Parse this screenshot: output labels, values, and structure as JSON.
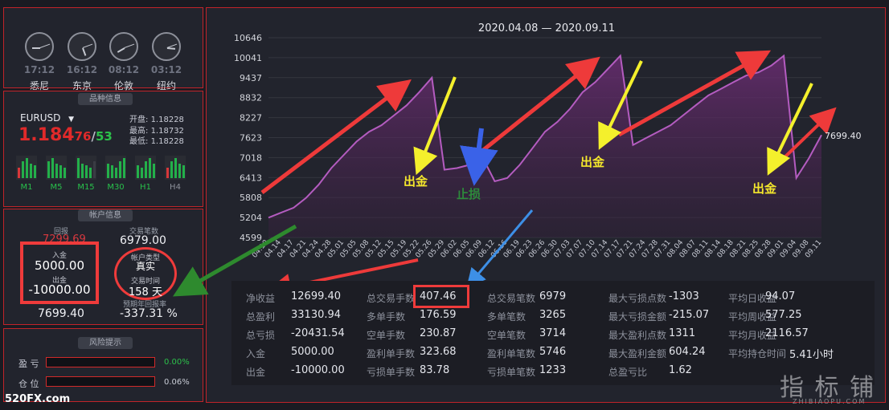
{
  "clocks": [
    {
      "time": "17:12",
      "city": "悉尼"
    },
    {
      "time": "16:12",
      "city": "东京"
    },
    {
      "time": "08:12",
      "city": "伦敦"
    },
    {
      "time": "03:12",
      "city": "纽约"
    }
  ],
  "symbol_section": {
    "title": "品种信息",
    "symbol": "EURUSD",
    "price_big": "1.184",
    "price_bid_tail": "76",
    "price_sep": "/",
    "price_ask_tail": "53",
    "open_label": "开盘:",
    "open": "1.18228",
    "high_label": "最高:",
    "high": "1.18732",
    "low_label": "最低:",
    "low": "1.18228",
    "timeframes": [
      "M1",
      "M5",
      "M15",
      "M30",
      "H1",
      "H4"
    ]
  },
  "account_section": {
    "title": "帐户信息",
    "return_label": "回报",
    "return_value": "7299.69",
    "trades_label": "交易笔数",
    "trades_value": "6979.00",
    "deposit_label": "入金",
    "deposit_value": "5000.00",
    "withdraw_label": "出金",
    "withdraw_value": "-10000.00",
    "account_type_label": "帐户类型",
    "account_type_value": "真实",
    "trade_time_label": "交易时间",
    "trade_time_value": "158 天",
    "balance_value": "7699.40",
    "annual_label": "预期年回报率",
    "annual_value": "-337.31 %"
  },
  "risk_section": {
    "title": "风险提示",
    "profit_label": "盈 亏",
    "profit_value": "0.00%",
    "position_label": "仓 位",
    "position_value": "0.06%"
  },
  "chart_data": {
    "type": "area",
    "title": "2020.04.08 — 2020.09.11",
    "y_ticks": [
      "10646",
      "10041",
      "9437",
      "8832",
      "8227",
      "7623",
      "7018",
      "6413",
      "5808",
      "5204",
      "4599"
    ],
    "ylim": [
      4599,
      10646
    ],
    "x_ticks": [
      "04.10",
      "04.14",
      "04.17",
      "04.21",
      "04.24",
      "04.28",
      "05.01",
      "05.05",
      "05.08",
      "05.12",
      "05.15",
      "05.19",
      "05.22",
      "05.26",
      "05.29",
      "06.02",
      "06.05",
      "06.09",
      "06.12",
      "06.16",
      "06.19",
      "06.23",
      "06.26",
      "06.30",
      "07.03",
      "07.07",
      "07.10",
      "07.14",
      "07.17",
      "07.21",
      "07.24",
      "07.28",
      "07.31",
      "08.04",
      "08.07",
      "08.11",
      "08.14",
      "08.18",
      "08.21",
      "08.25",
      "08.28",
      "09.01",
      "09.04",
      "09.08",
      "09.11"
    ],
    "last_value_label": "7699.40",
    "series": [
      {
        "values": [
          5200,
          5350,
          5500,
          5800,
          6200,
          6700,
          7100,
          7500,
          7800,
          8000,
          8300,
          8600,
          9000,
          9437,
          6650,
          6700,
          6800,
          7050,
          6300,
          6400,
          6800,
          7300,
          7800,
          8100,
          8500,
          9000,
          9300,
          9700,
          10100,
          7400,
          7600,
          7800,
          8000,
          8300,
          8600,
          8900,
          9100,
          9300,
          9500,
          9600,
          9800,
          10100,
          6400,
          7000,
          7699
        ]
      }
    ],
    "colors": {
      "line": "#b45cc0",
      "fill": "#4c2452"
    }
  },
  "annotations": {
    "withdraw_1": "出金",
    "stop_loss": "止损",
    "withdraw_2": "出金",
    "withdraw_3": "出金"
  },
  "stats": {
    "col1": [
      {
        "label": "净收益",
        "value": "12699.40"
      },
      {
        "label": "总盈利",
        "value": "33130.94"
      },
      {
        "label": "总亏损",
        "value": "-20431.54"
      },
      {
        "label": "入金",
        "value": "5000.00"
      },
      {
        "label": "出金",
        "value": "-10000.00"
      }
    ],
    "col2": [
      {
        "label": "总交易手数",
        "value": "407.46"
      },
      {
        "label": "多单手数",
        "value": "176.59"
      },
      {
        "label": "空单手数",
        "value": "230.87"
      },
      {
        "label": "盈利单手数",
        "value": "323.68"
      },
      {
        "label": "亏损单手数",
        "value": "83.78"
      }
    ],
    "col3": [
      {
        "label": "总交易笔数",
        "value": "6979"
      },
      {
        "label": "多单笔数",
        "value": "3265"
      },
      {
        "label": "空单笔数",
        "value": "3714"
      },
      {
        "label": "盈利单笔数",
        "value": "5746"
      },
      {
        "label": "亏损单笔数",
        "value": "1233"
      }
    ],
    "col4": [
      {
        "label": "最大亏损点数",
        "value": "-1303"
      },
      {
        "label": "最大亏损金额",
        "value": "-215.07"
      },
      {
        "label": "最大盈利点数",
        "value": "1311"
      },
      {
        "label": "最大盈利金额",
        "value": "604.24"
      },
      {
        "label": "总盈亏比",
        "value": "1.62"
      }
    ],
    "col5": [
      {
        "label": "平均日收益",
        "value": "94.07"
      },
      {
        "label": "平均周收益",
        "value": "577.25"
      },
      {
        "label": "平均月收益",
        "value": "2116.57"
      },
      {
        "label": "平均持仓时间",
        "value": "5.41小时"
      }
    ]
  },
  "watermarks": {
    "left": "520FX.com",
    "right_cn": "指 标 铺",
    "right_en": "ZHIBIAOPU.COM"
  }
}
